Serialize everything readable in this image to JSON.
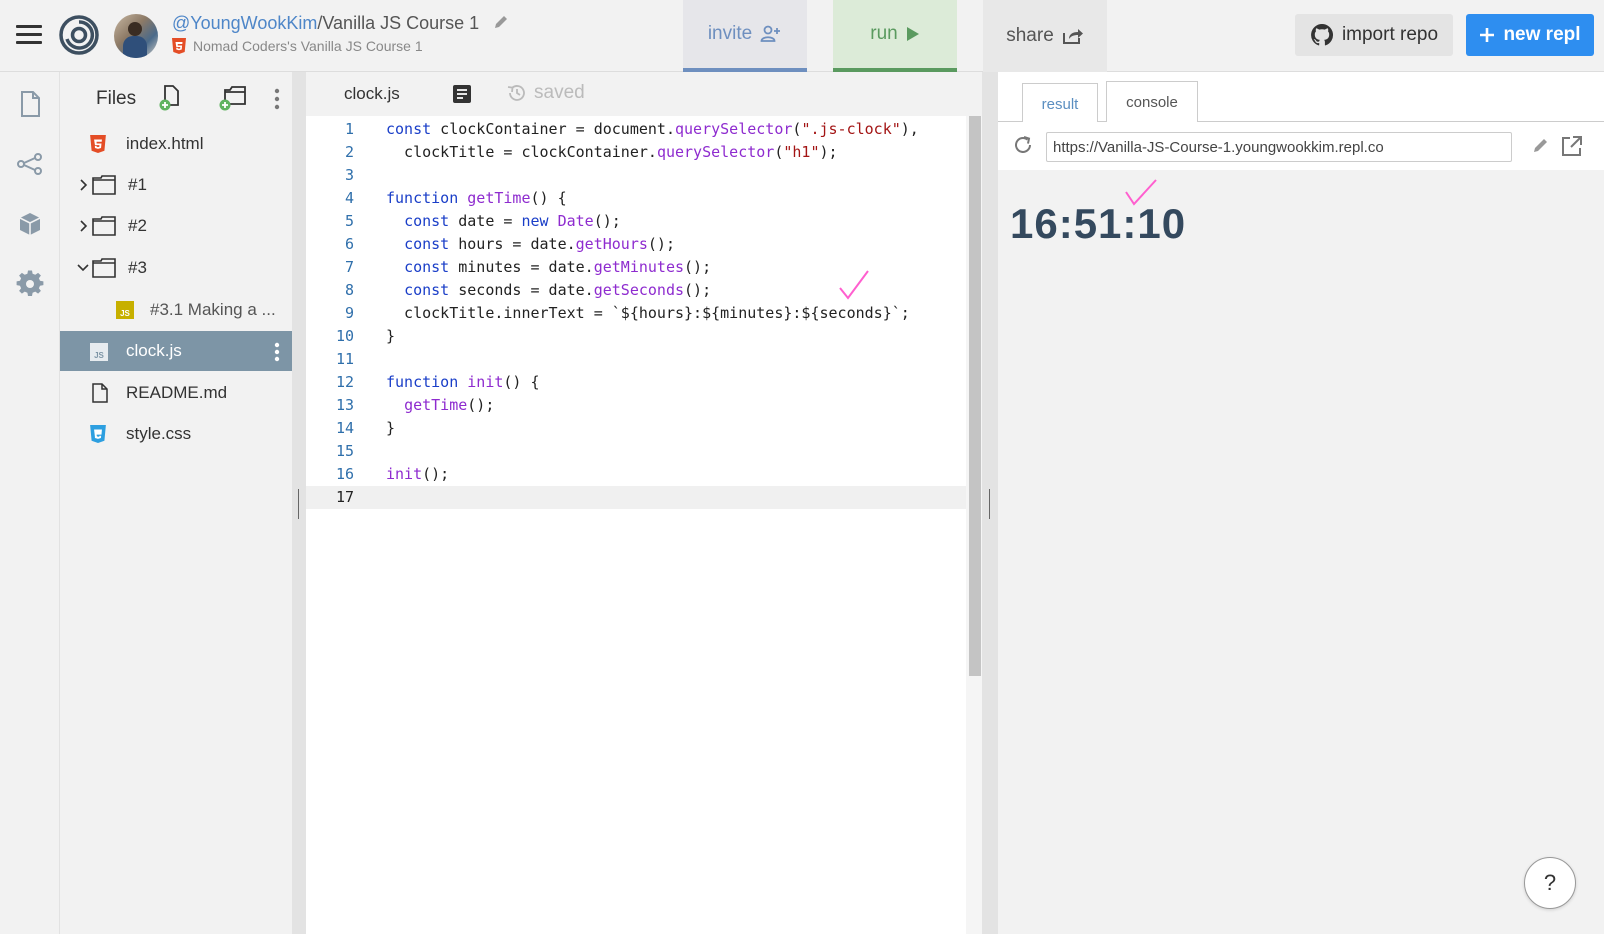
{
  "header": {
    "owner": "@YoungWookKim",
    "separator": "/",
    "repl_name": "Vanilla JS Course 1",
    "subtitle": "Nomad Coders's Vanilla JS Course 1",
    "invite_label": "invite",
    "run_label": "run",
    "share_label": "share",
    "import_label": "import repo",
    "new_repl_label": "new repl",
    "colors": {
      "invite": "#6e8fbf",
      "run": "#5a9a5f",
      "new_repl_bg": "#2e8ef0"
    }
  },
  "rail": {
    "icons": [
      "file-icon",
      "share-network-icon",
      "package-icon",
      "settings-gear-icon"
    ]
  },
  "files": {
    "title": "Files",
    "items": [
      {
        "label": "index.html",
        "type": "html"
      },
      {
        "label": "#1",
        "type": "folder",
        "state": "collapsed"
      },
      {
        "label": "#2",
        "type": "folder",
        "state": "collapsed"
      },
      {
        "label": "#3",
        "type": "folder",
        "state": "expanded"
      },
      {
        "label": "#3.1 Making a ...",
        "type": "js"
      },
      {
        "label": "clock.js",
        "type": "js",
        "selected": true
      },
      {
        "label": "README.md",
        "type": "file"
      },
      {
        "label": "style.css",
        "type": "css"
      }
    ]
  },
  "editor": {
    "tab_label": "clock.js",
    "saved_label": "saved",
    "active_line": 17,
    "lines": [
      [
        {
          "t": "kw",
          "v": "const"
        },
        {
          "t": "",
          "v": " clockContainer = document."
        },
        {
          "t": "fn",
          "v": "querySelector"
        },
        {
          "t": "",
          "v": "("
        },
        {
          "t": "str",
          "v": "\".js-clock\""
        },
        {
          "t": "",
          "v": "),"
        }
      ],
      [
        {
          "t": "",
          "v": "  clockTitle = clockContainer."
        },
        {
          "t": "fn",
          "v": "querySelector"
        },
        {
          "t": "",
          "v": "("
        },
        {
          "t": "str",
          "v": "\"h1\""
        },
        {
          "t": "",
          "v": ");"
        }
      ],
      [],
      [
        {
          "t": "kw",
          "v": "function"
        },
        {
          "t": "",
          "v": " "
        },
        {
          "t": "fn",
          "v": "getTime"
        },
        {
          "t": "",
          "v": "() {"
        }
      ],
      [
        {
          "t": "",
          "v": "  "
        },
        {
          "t": "kw",
          "v": "const"
        },
        {
          "t": "",
          "v": " date = "
        },
        {
          "t": "kw",
          "v": "new"
        },
        {
          "t": "",
          "v": " "
        },
        {
          "t": "fn",
          "v": "Date"
        },
        {
          "t": "",
          "v": "();"
        }
      ],
      [
        {
          "t": "",
          "v": "  "
        },
        {
          "t": "kw",
          "v": "const"
        },
        {
          "t": "",
          "v": " hours = date."
        },
        {
          "t": "fn",
          "v": "getHours"
        },
        {
          "t": "",
          "v": "();"
        }
      ],
      [
        {
          "t": "",
          "v": "  "
        },
        {
          "t": "kw",
          "v": "const"
        },
        {
          "t": "",
          "v": " minutes = date."
        },
        {
          "t": "fn",
          "v": "getMinutes"
        },
        {
          "t": "",
          "v": "();"
        }
      ],
      [
        {
          "t": "",
          "v": "  "
        },
        {
          "t": "kw",
          "v": "const"
        },
        {
          "t": "",
          "v": " seconds = date."
        },
        {
          "t": "fn",
          "v": "getSeconds"
        },
        {
          "t": "",
          "v": "();"
        }
      ],
      [
        {
          "t": "",
          "v": "  clockTitle.innerText = "
        },
        {
          "t": "tmp",
          "v": "`${hours}:${minutes}:${seconds}`"
        },
        {
          "t": "",
          "v": ";"
        }
      ],
      [
        {
          "t": "",
          "v": "}"
        }
      ],
      [],
      [
        {
          "t": "kw",
          "v": "function"
        },
        {
          "t": "",
          "v": " "
        },
        {
          "t": "fn",
          "v": "init"
        },
        {
          "t": "",
          "v": "() {"
        }
      ],
      [
        {
          "t": "",
          "v": "  "
        },
        {
          "t": "fn",
          "v": "getTime"
        },
        {
          "t": "",
          "v": "();"
        }
      ],
      [
        {
          "t": "",
          "v": "}"
        }
      ],
      [],
      [
        {
          "t": "fn",
          "v": "init"
        },
        {
          "t": "",
          "v": "();"
        }
      ],
      []
    ]
  },
  "result": {
    "tabs": [
      "result",
      "console"
    ],
    "active_tab": "result",
    "url": "https://Vanilla-JS-Course-1.youngwookkim.repl.co",
    "clock_text": "16:51:10",
    "help_label": "?"
  }
}
